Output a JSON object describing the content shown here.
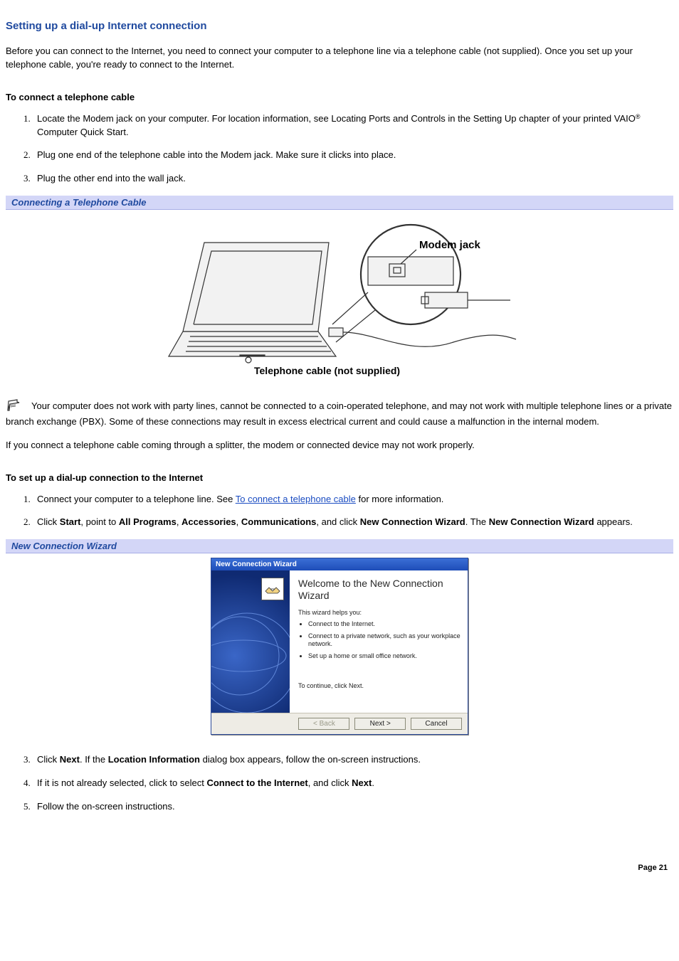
{
  "title": "Setting up a dial-up Internet connection",
  "intro": "Before you can connect to the Internet, you need to connect your computer to a telephone line via a telephone cable (not supplied). Once you set up your telephone cable, you're ready to connect to the Internet.",
  "section1": {
    "heading": "To connect a telephone cable",
    "steps": [
      {
        "pre": "Locate the Modem jack on your computer. For location information, see Locating Ports and Controls in the Setting Up chapter of your printed VAIO",
        "reg": "®",
        "post": " Computer Quick Start."
      },
      {
        "text": "Plug one end of the telephone cable into the Modem jack. Make sure it clicks into place."
      },
      {
        "text": "Plug the other end into the wall jack."
      }
    ]
  },
  "figure1": {
    "caption": "Connecting a Telephone Cable",
    "label_modem": "Modem jack",
    "label_cable": "Telephone cable (not supplied)"
  },
  "note1": "Your computer does not work with party lines, cannot be connected to a coin-operated telephone, and may not work with multiple telephone lines or a private branch exchange (PBX). Some of these connections may result in excess electrical current and could cause a malfunction in the internal modem.",
  "note2": "If you connect a telephone cable coming through a splitter, the modem or connected device may not work properly.",
  "section2": {
    "heading": "To set up a dial-up connection to the Internet",
    "step1_pre": "Connect your computer to a telephone line. See ",
    "step1_link": "To connect a telephone cable",
    "step1_post": " for more information.",
    "step2_parts": {
      "p0": "Click ",
      "b1": "Start",
      "p1": ", point to ",
      "b2": "All Programs",
      "p2": ", ",
      "b3": "Accessories",
      "p3": ", ",
      "b4": "Communications",
      "p4": ", and click ",
      "b5": "New Connection Wizard",
      "p5": ". The ",
      "b6": "New Connection Wizard",
      "p6": " appears."
    },
    "step3_parts": {
      "p0": "Click ",
      "b1": "Next",
      "p1": ". If the ",
      "b2": "Location Information",
      "p2": " dialog box appears, follow the on-screen instructions."
    },
    "step4_parts": {
      "p0": "If it is not already selected, click to select ",
      "b1": "Connect to the Internet",
      "p1": ", and click ",
      "b2": "Next",
      "p2": "."
    },
    "step5": "Follow the on-screen instructions."
  },
  "figure2": {
    "caption": "New Connection Wizard"
  },
  "wizard": {
    "title": "New Connection Wizard",
    "heading": "Welcome to the New Connection Wizard",
    "helps": "This wizard helps you:",
    "bullets": [
      "Connect to the Internet.",
      "Connect to a private network, such as your workplace network.",
      "Set up a home or small office network."
    ],
    "continue": "To continue, click Next.",
    "buttons": {
      "back": "< Back",
      "next": "Next >",
      "cancel": "Cancel"
    }
  },
  "page_number": "Page 21"
}
